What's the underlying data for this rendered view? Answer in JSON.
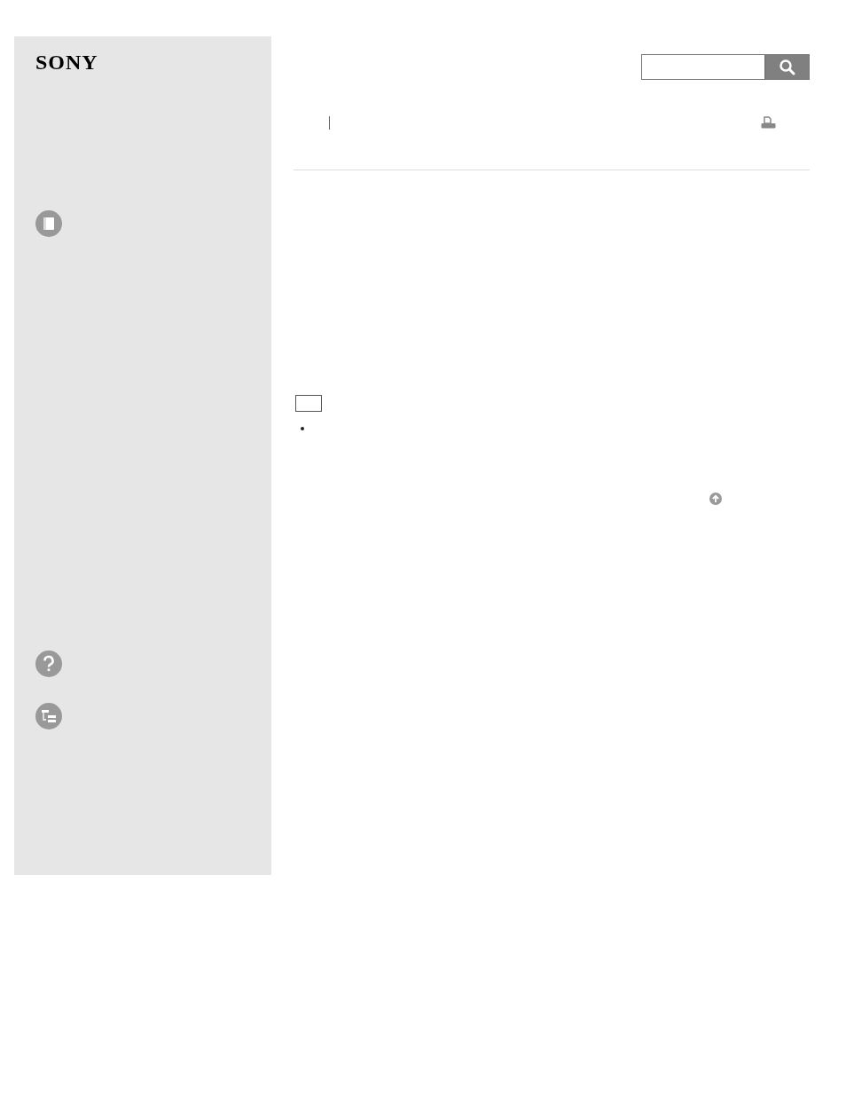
{
  "logo": "SONY"
}
